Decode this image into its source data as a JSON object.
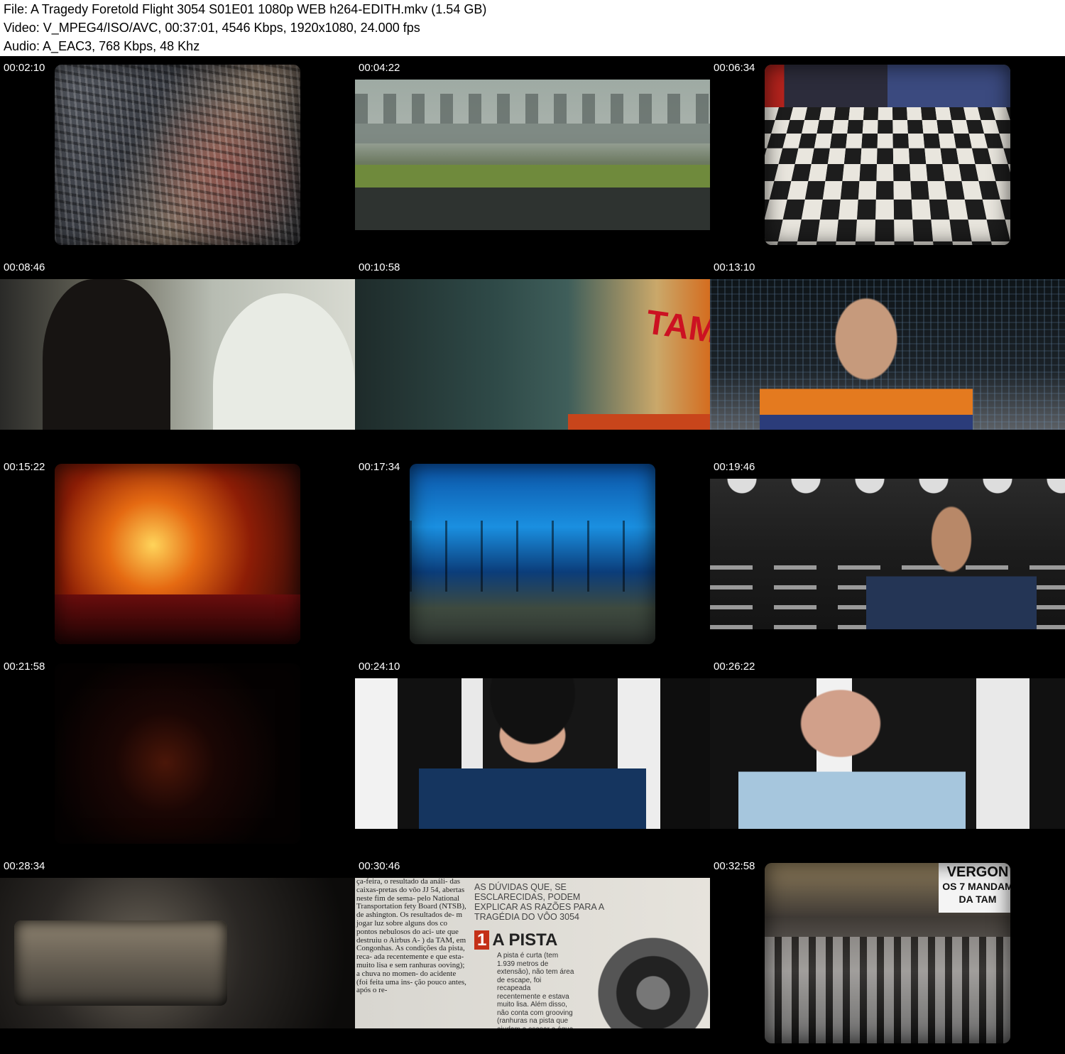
{
  "header": {
    "file_line": "File: A Tragedy Foretold Flight 3054 S01E01 1080p WEB h264-EDITH.mkv (1.54 GB)",
    "video_line": "Video: V_MPEG4/ISO/AVC, 00:37:01, 4546 Kbps, 1920x1080, 24.000 fps",
    "audio_line": "Audio: A_EAC3, 768 Kbps, 48 Khz"
  },
  "thumbnails": [
    {
      "timestamp": "00:02:10"
    },
    {
      "timestamp": "00:04:22"
    },
    {
      "timestamp": "00:06:34"
    },
    {
      "timestamp": "00:08:46"
    },
    {
      "timestamp": "00:10:58"
    },
    {
      "timestamp": "00:13:10"
    },
    {
      "timestamp": "00:15:22"
    },
    {
      "timestamp": "00:17:34"
    },
    {
      "timestamp": "00:19:46"
    },
    {
      "timestamp": "00:21:58"
    },
    {
      "timestamp": "00:24:10"
    },
    {
      "timestamp": "00:26:22"
    },
    {
      "timestamp": "00:28:34"
    },
    {
      "timestamp": "00:30:46"
    },
    {
      "timestamp": "00:32:58"
    }
  ],
  "frame_text": {
    "tam_sign": "TAM",
    "newspaper_column": "ça-feira, o resultado da análi- das caixas-pretas do vôo JJ 54, abertas neste fim de sema- pelo National Transportation fety Board (NTSB), de ashington. Os resultados de- m jogar luz sobre alguns dos co pontos nebulosos do aci- ute que destruiu o Airbus A- ) da TAM, em Congonhas. As condições da pista, reca- ada recentemente e que esta- muito lisa e sem ranhuras ooving); a chuva no momen- do acidente (foi feita uma ins- ção pouco antes, após o re-",
    "newspaper_heading": "AS DÚVIDAS QUE, SE ESCLARECIDAS, PODEM EXPLICAR AS RAZÕES PARA A TRAGÉDIA DO VÔO 3054",
    "pista_number": "1",
    "pista_title": "A PISTA",
    "pista_body": "A pista é curta (tem 1.939 metros de extensão), não tem área de escape, foi recapeada recentemente e estava muito lisa. Além disso, não conta com grooving (ranhuras na pista que ajudam a escoar a água da chuva)",
    "protest_banner_1": "VERGON",
    "protest_banner_2": "OS 7 MANDAM",
    "protest_banner_3": "DA TAM"
  }
}
